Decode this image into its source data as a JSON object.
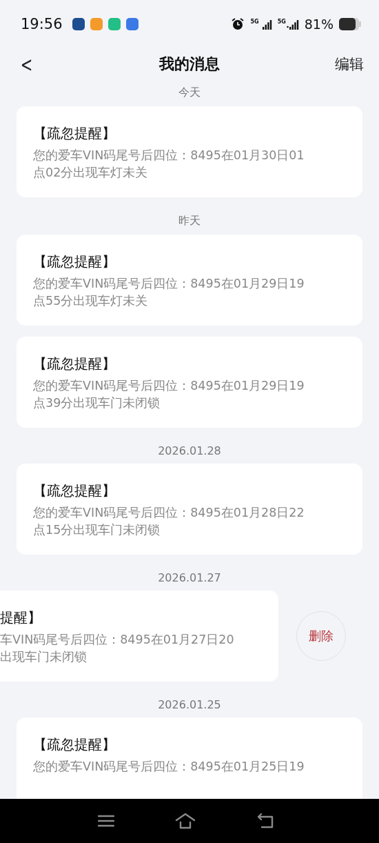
{
  "status_bar": {
    "time": "19:56",
    "battery": "81%",
    "network_labels": [
      "5G",
      "5G"
    ]
  },
  "header": {
    "back": "<",
    "title": "我的消息",
    "action": "编辑"
  },
  "sections": [
    {
      "date": "今天",
      "messages": [
        {
          "title": "【疏忽提醒】",
          "lines": [
            "您的爱车VIN码尾号后四位：8495在01月30日01",
            "点02分出现车灯未关"
          ],
          "swiped": false
        }
      ]
    },
    {
      "date": "昨天",
      "messages": [
        {
          "title": "【疏忽提醒】",
          "lines": [
            "您的爱车VIN码尾号后四位：8495在01月29日19",
            "点55分出现车灯未关"
          ],
          "swiped": false
        },
        {
          "title": "【疏忽提醒】",
          "lines": [
            "您的爱车VIN码尾号后四位：8495在01月29日19",
            "点39分出现车门未闭锁"
          ],
          "swiped": false
        }
      ]
    },
    {
      "date": "2026.01.28",
      "messages": [
        {
          "title": "【疏忽提醒】",
          "lines": [
            "您的爱车VIN码尾号后四位：8495在01月28日22",
            "点15分出现车门未闭锁"
          ],
          "swiped": false
        }
      ]
    },
    {
      "date": "2026.01.27",
      "messages": [
        {
          "title": "提醒】",
          "lines": [
            "车VIN码尾号后四位：8495在01月27日20",
            "出现车门未闭锁"
          ],
          "swiped": true,
          "delete_label": "删除"
        }
      ]
    },
    {
      "date": "2026.01.25",
      "messages": [
        {
          "title": "【疏忽提醒】",
          "lines": [
            "您的爱车VIN码尾号后四位：8495在01月25日19"
          ],
          "swiped": false
        }
      ]
    }
  ]
}
